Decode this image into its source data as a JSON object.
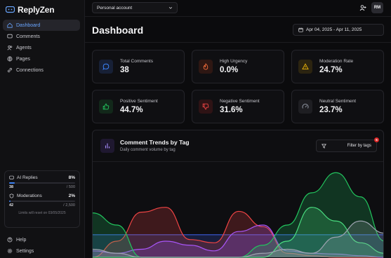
{
  "app": {
    "name": "ReplyZen"
  },
  "nav": {
    "items": [
      {
        "label": "Dashboard",
        "icon": "home-icon",
        "active": true
      },
      {
        "label": "Comments",
        "icon": "message-icon"
      },
      {
        "label": "Agents",
        "icon": "users-icon"
      },
      {
        "label": "Pages",
        "icon": "globe-icon"
      },
      {
        "label": "Connections",
        "icon": "link-icon"
      }
    ],
    "bottom": [
      {
        "label": "Help",
        "icon": "help-circle-icon"
      },
      {
        "label": "Settings",
        "icon": "gear-icon"
      }
    ]
  },
  "usage": {
    "ai_replies": {
      "label": "AI Replies",
      "percent": "8%",
      "used": "38",
      "limit": "/ 500",
      "fill": 0.08
    },
    "moderations": {
      "label": "Moderations",
      "percent": "2%",
      "used": "42",
      "limit": "/ 2,500",
      "fill": 0.02
    },
    "reset_note": "Limits will reset on 03/05/2025"
  },
  "topbar": {
    "account": "Personal account",
    "avatar_initials": "RM"
  },
  "header": {
    "title": "Dashboard",
    "date_range": "Apr 04, 2025 - Apr 11, 2025"
  },
  "stats": [
    {
      "title": "Total Comments",
      "value": "38",
      "icon": "chat-bubble-icon",
      "color": "#3b82f6",
      "bg": "#172036"
    },
    {
      "title": "High Urgency",
      "value": "0.0%",
      "icon": "flame-icon",
      "color": "#ef6a3a",
      "bg": "#2e1713"
    },
    {
      "title": "Moderation Rate",
      "value": "24.7%",
      "icon": "warning-icon",
      "color": "#eab308",
      "bg": "#2c2410"
    },
    {
      "title": "Positive Sentiment",
      "value": "44.7%",
      "icon": "thumbs-up-icon",
      "color": "#22c55e",
      "bg": "#12281a"
    },
    {
      "title": "Negative Sentiment",
      "value": "31.6%",
      "icon": "thumbs-down-icon",
      "color": "#ef4444",
      "bg": "#2e1315"
    },
    {
      "title": "Neutral Sentiment",
      "value": "23.7%",
      "icon": "gauge-icon",
      "color": "#9ca3af",
      "bg": "#1e1e22"
    }
  ],
  "trend": {
    "title": "Comment Trends by Tag",
    "subtitle": "Daily comment volume by tag",
    "filter_label": "Filter by tags",
    "filter_count": "5"
  },
  "chart_data": {
    "type": "area",
    "ylim": [
      0,
      100
    ],
    "x": [
      0,
      1,
      2,
      3,
      4,
      5,
      6,
      7,
      8,
      9,
      10,
      11,
      12
    ],
    "series": [
      {
        "color": "#3b5bdb",
        "values": [
          28,
          28,
          28,
          28,
          28,
          28,
          28,
          28,
          28,
          28,
          28,
          28,
          28
        ]
      },
      {
        "color": "#ef4444",
        "values": [
          0,
          20,
          56,
          62,
          22,
          18,
          57,
          38,
          5,
          2,
          0,
          0,
          0
        ]
      },
      {
        "color": "#a855f7",
        "values": [
          8,
          5,
          10,
          20,
          15,
          8,
          32,
          40,
          8,
          5,
          4,
          2,
          0
        ]
      },
      {
        "color": "#22c55e",
        "values": [
          55,
          40,
          0,
          0,
          0,
          0,
          0,
          15,
          40,
          80,
          105,
          75,
          20
        ]
      },
      {
        "color": "#4ade80",
        "values": [
          0,
          0,
          0,
          0,
          0,
          0,
          0,
          0,
          20,
          62,
          45,
          18,
          5
        ]
      },
      {
        "color": "#9ca3af",
        "values": [
          10,
          5,
          0,
          0,
          0,
          0,
          0,
          5,
          10,
          5,
          25,
          45,
          30
        ]
      }
    ]
  }
}
